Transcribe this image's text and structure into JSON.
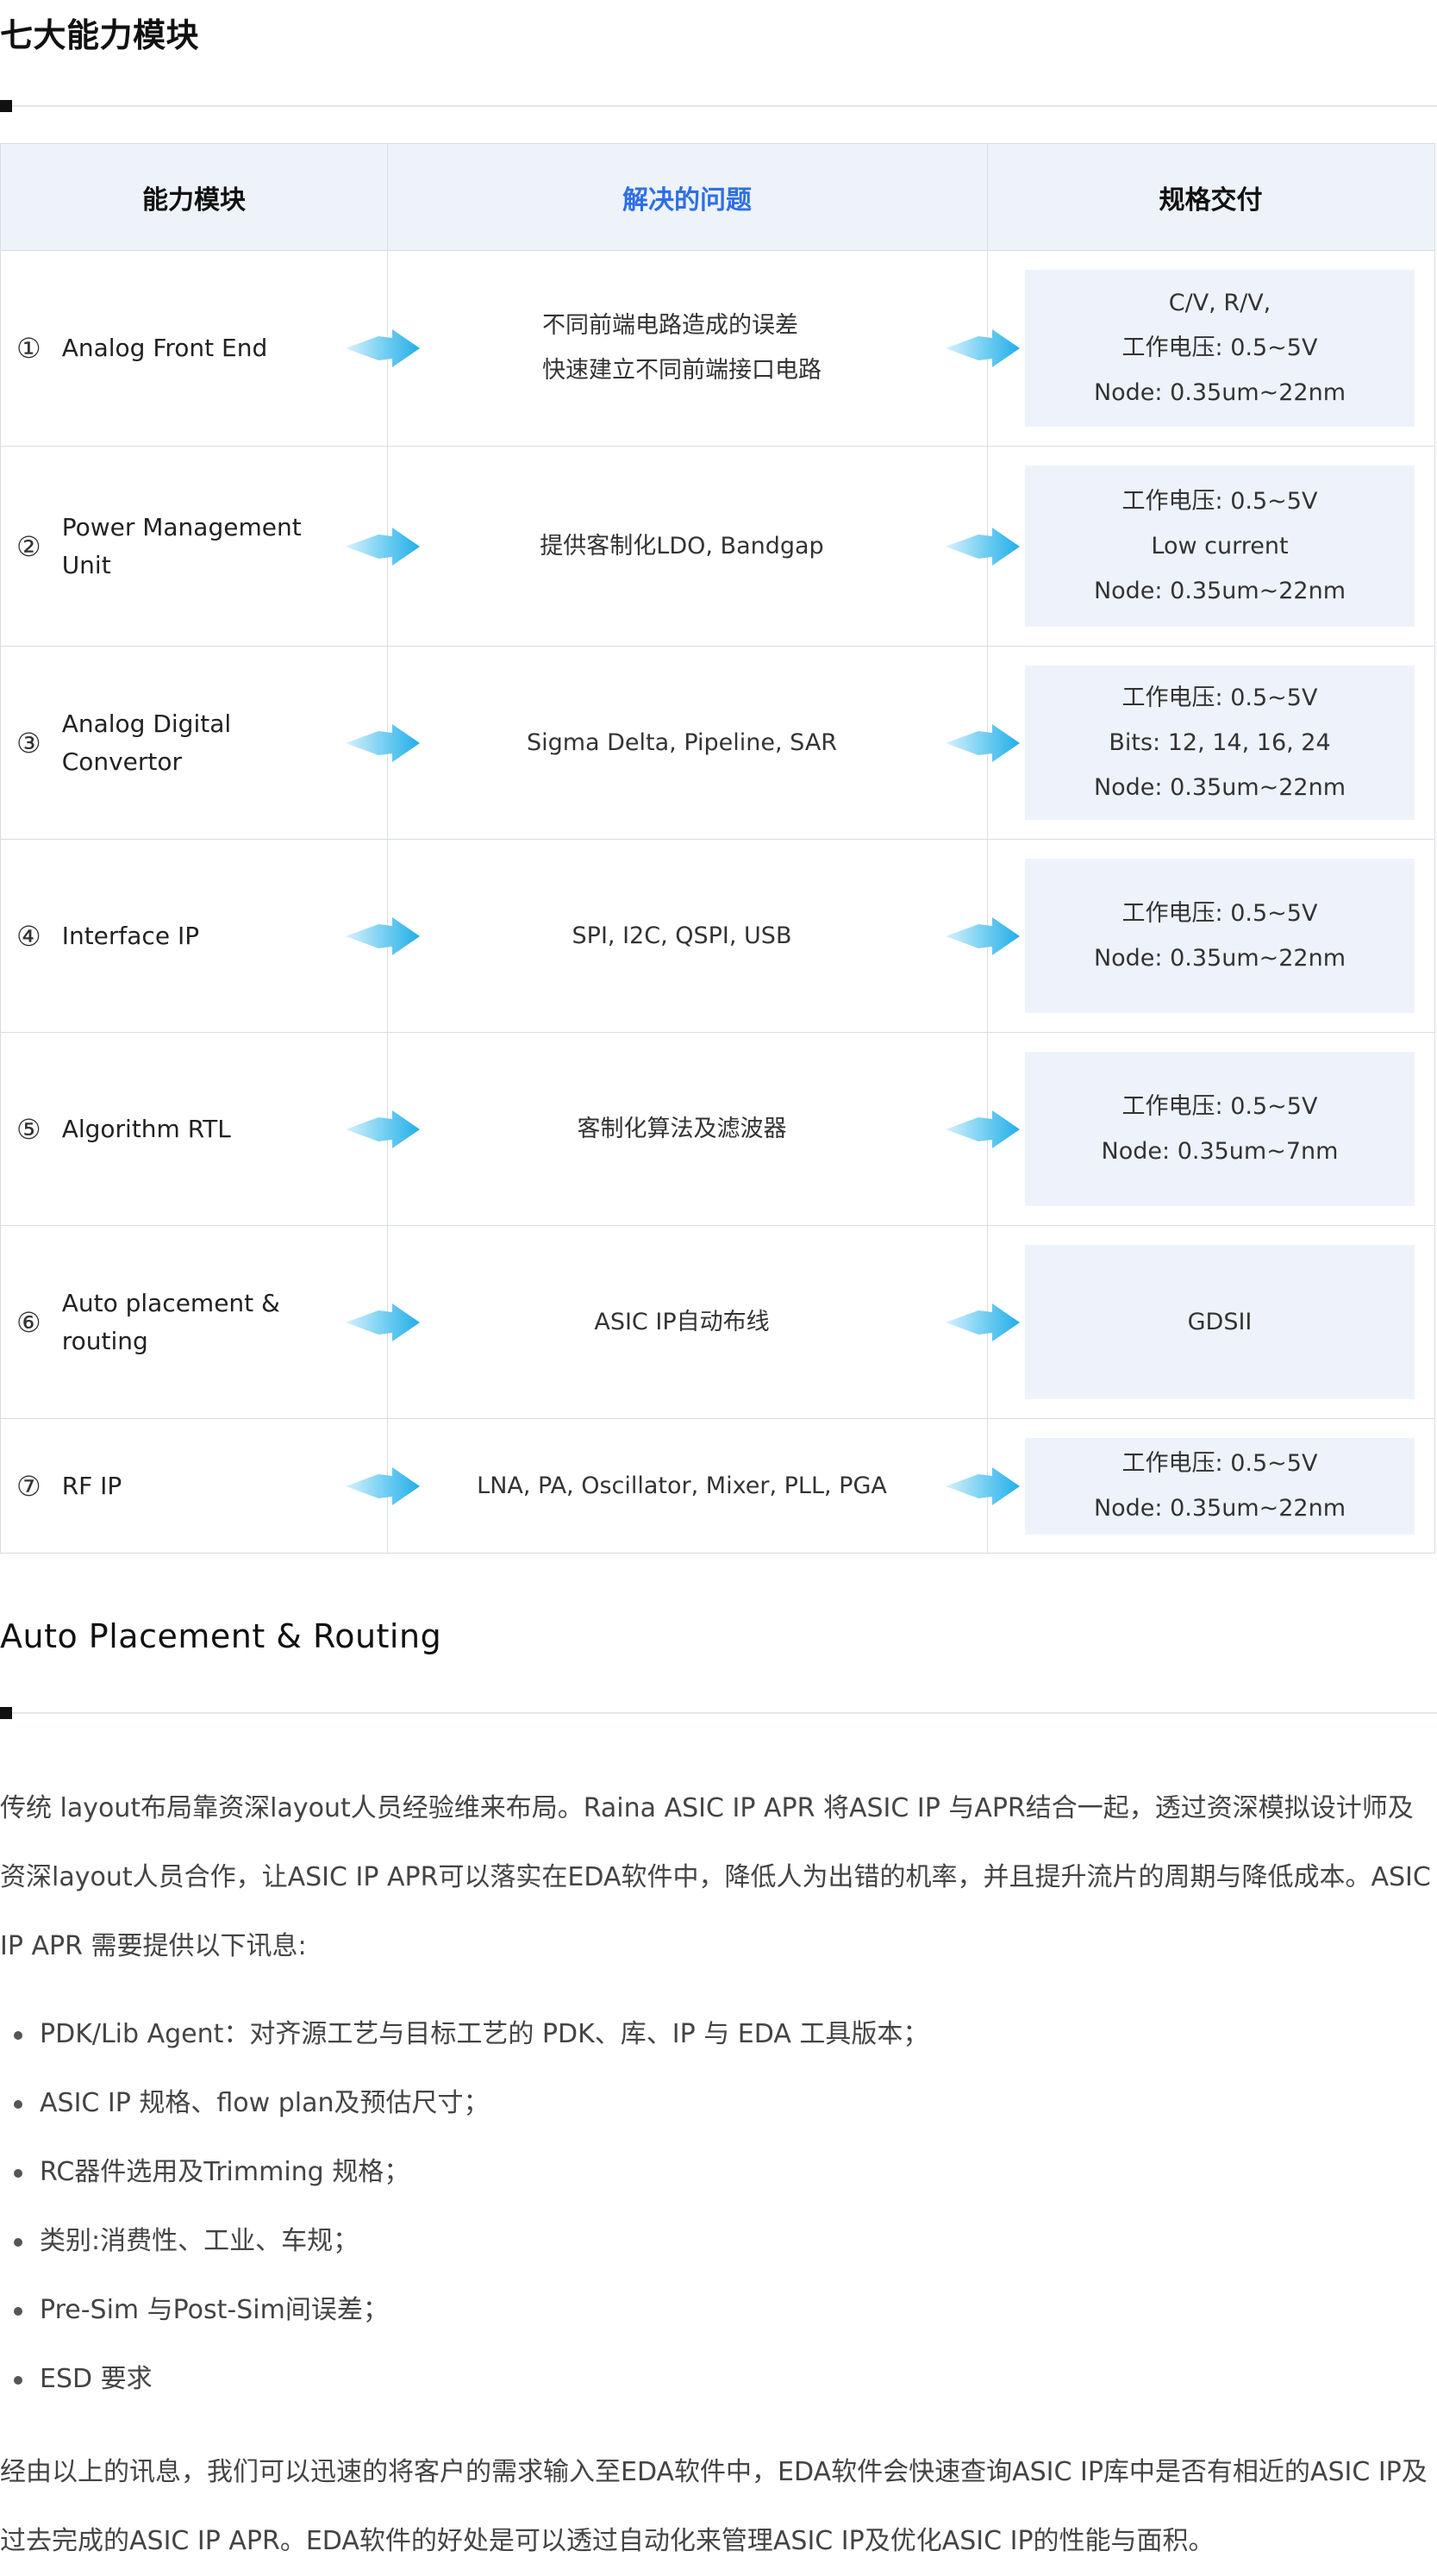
{
  "section1": {
    "title": "七大能力模块"
  },
  "table": {
    "headers": {
      "module": "能力模块",
      "problem": "解决的问题",
      "delivery": "规格交付"
    },
    "rows": [
      {
        "num": "1",
        "module": "Analog Front End",
        "problem": [
          "不同前端电路造成的误差",
          "快速建立不同前端接口电路"
        ],
        "spec": [
          "C/V, R/V,",
          "工作电压: 0.5~5V",
          "Node: 0.35um~22nm"
        ]
      },
      {
        "num": "2",
        "module": "Power Management\nUnit",
        "problem": [
          "提供客制化LDO, Bandgap"
        ],
        "spec": [
          "工作电压: 0.5~5V",
          "Low current",
          "Node: 0.35um~22nm"
        ]
      },
      {
        "num": "3",
        "module": "Analog Digital Convertor",
        "problem": [
          "Sigma Delta, Pipeline, SAR"
        ],
        "spec": [
          "工作电压: 0.5~5V",
          "Bits: 12, 14, 16, 24",
          "Node: 0.35um~22nm"
        ]
      },
      {
        "num": "4",
        "module": "Interface IP",
        "problem": [
          "SPI, I2C, QSPI, USB"
        ],
        "spec": [
          "工作电压: 0.5~5V",
          "Node: 0.35um~22nm"
        ]
      },
      {
        "num": "5",
        "module": "Algorithm RTL",
        "problem": [
          "客制化算法及滤波器"
        ],
        "spec": [
          "工作电压: 0.5~5V",
          "Node: 0.35um~7nm"
        ]
      },
      {
        "num": "6",
        "module": "Auto placement &\nrouting",
        "problem": [
          "ASIC IP自动布线"
        ],
        "spec": [
          "GDSII"
        ]
      },
      {
        "num": "7",
        "module": "RF IP",
        "problem": [
          "LNA, PA, Oscillator, Mixer, PLL, PGA"
        ],
        "spec": [
          "工作电压: 0.5~5V",
          "Node: 0.35um~22nm"
        ]
      }
    ]
  },
  "section2": {
    "title": "Auto Placement & Routing",
    "intro": "传统 layout布局靠资深layout人员经验维来布局。Raina ASIC IP APR 将ASIC IP 与APR结合一起，透过资深模拟设计师及资深layout人员合作，让ASIC IP APR可以落实在EDA软件中，降低人为出错的机率，并且提升流片的周期与降低成本。ASIC IP APR 需要提供以下讯息:",
    "requirements": [
      "PDK/Lib Agent：对齐源工艺与目标工艺的 PDK、库、IP 与 EDA 工具版本；",
      "ASIC IP 规格、flow plan及预估尺寸；",
      "RC器件选用及Trimming 规格；",
      "类别:消费性、工业、车规；",
      "Pre-Sim 与Post-Sim间误差；",
      "ESD 要求"
    ],
    "conclusion": "经由以上的讯息，我们可以迅速的将客户的需求输入至EDA软件中，EDA软件会快速查询ASIC IP库中是否有相近的ASIC IP及过去完成的ASIC IP APR。EDA软件的好处是可以透过自动化来管理ASIC IP及优化ASIC IP的性能与面积。"
  }
}
